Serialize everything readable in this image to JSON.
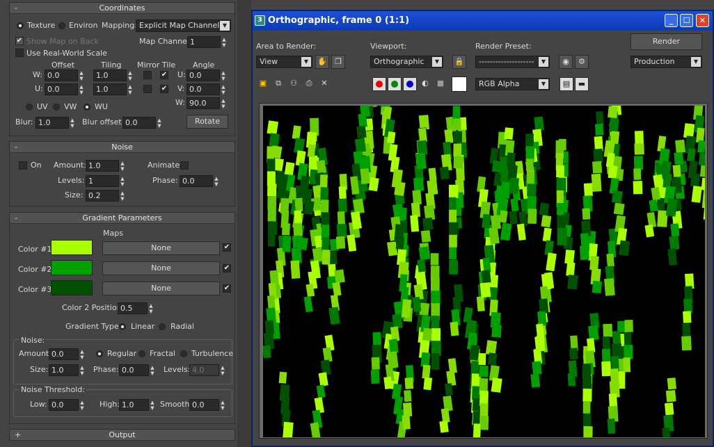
{
  "left_panel": {
    "coordinates": {
      "title": "Coordinates",
      "collapse": "-",
      "texture": "Texture",
      "environ": "Environ",
      "mapping_label": "Mapping:",
      "mapping_value": "Explicit Map Channel",
      "show_map_on_back": "Show Map on Back",
      "map_channel_label": "Map Channel:",
      "map_channel_value": "1",
      "use_real_world": "Use Real-World Scale",
      "offset": "Offset",
      "tiling": "Tiling",
      "mirror_tile": "Mirror Tile",
      "angle": "Angle",
      "w": "W:",
      "u": "U:",
      "v": "V:",
      "offset_w": "0.0",
      "offset_u": "0.0",
      "tiling_w": "1.0",
      "tiling_u": "1.0",
      "angle_u": "0.0",
      "angle_v": "0.0",
      "angle_w": "90.0",
      "uv": "UV",
      "vw": "VW",
      "wu": "WU",
      "blur_label": "Blur:",
      "blur_value": "1.0",
      "blur_offset_label": "Blur offset:",
      "blur_offset_value": "0.0",
      "rotate": "Rotate"
    },
    "noise": {
      "title": "Noise",
      "collapse": "-",
      "on": "On",
      "amount_label": "Amount:",
      "amount_value": "1.0",
      "animate": "Animate:",
      "levels_label": "Levels:",
      "levels_value": "1",
      "phase_label": "Phase:",
      "phase_value": "0.0",
      "size_label": "Size:",
      "size_value": "0.2"
    },
    "gradient": {
      "title": "Gradient Parameters",
      "collapse": "-",
      "maps": "Maps",
      "color1": "Color #1",
      "color2": "Color #2",
      "color3": "Color #3",
      "none": "None",
      "color2_position_label": "Color 2 Position:",
      "color2_position_value": "0.5",
      "gradient_type_label": "Gradient Type:",
      "linear": "Linear",
      "radial": "Radial",
      "noise_group": "Noise:",
      "amount_label": "Amount:",
      "amount_value": "0.0",
      "regular": "Regular",
      "fractal": "Fractal",
      "turbulence": "Turbulence",
      "size_label": "Size:",
      "size_value": "1.0",
      "phase_label": "Phase:",
      "phase_value": "0.0",
      "levels_label": "Levels:",
      "levels_value": "4.0",
      "threshold_group": "Noise Threshold:",
      "low_label": "Low:",
      "low_value": "0.0",
      "high_label": "High:",
      "high_value": "1.0",
      "smooth_label": "Smooth:",
      "smooth_value": "0.0",
      "colors": {
        "c1": "#aaff00",
        "c2": "#00a000",
        "c3": "#005000"
      }
    },
    "output": {
      "title": "Output",
      "expand": "+"
    }
  },
  "render_window": {
    "title": "Orthographic, frame 0 (1:1)",
    "area_to_render_label": "Area to Render:",
    "area_value": "View",
    "viewport_label": "Viewport:",
    "viewport_value": "Orthographic",
    "render_preset_label": "Render Preset:",
    "render_preset_value": "--------------------",
    "render_button": "Render",
    "production_value": "Production",
    "channel_value": "RGB Alpha",
    "accent": "#0a3bb6"
  }
}
